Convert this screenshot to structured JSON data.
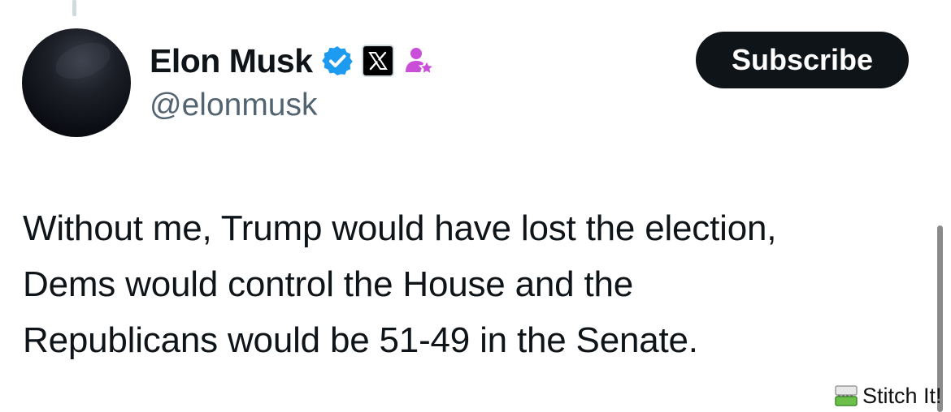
{
  "author": {
    "display_name": "Elon Musk",
    "handle": "@elonmusk",
    "verified_badge_color": "#1d9bf0",
    "affiliate_badge_icon": "x-logo-icon",
    "extra_badge_icon": "person-star-icon",
    "extra_badge_color": "#c94fd8"
  },
  "actions": {
    "subscribe_label": "Subscribe"
  },
  "tweet": {
    "lines": [
      "Without me, Trump would have lost the election,",
      "Dems would control the House and the",
      "Republicans would be 51-49 in the Senate."
    ]
  },
  "watermark": {
    "label": "Stitch It!"
  }
}
